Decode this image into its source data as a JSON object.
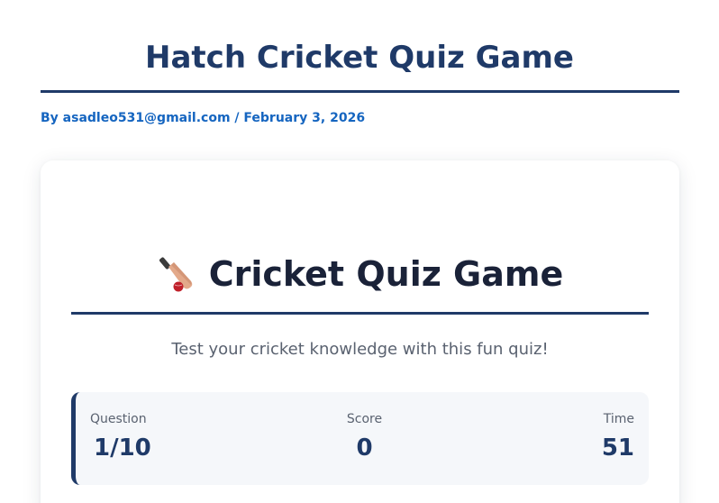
{
  "post": {
    "title": "Hatch Cricket Quiz Game",
    "byline_prefix": "By",
    "author": "asadleo531@gmail.com",
    "separator": "/",
    "date": "February 3, 2026"
  },
  "quiz": {
    "title": "Cricket Quiz Game",
    "title_icon": "cricket-bat-icon",
    "subtitle": "Test your cricket knowledge with this fun quiz!",
    "stats": {
      "question_label": "Question",
      "question_value": "1/10",
      "score_label": "Score",
      "score_value": "0",
      "time_label": "Time",
      "time_value": "51"
    }
  },
  "colors": {
    "heading_navy": "#1f3a68",
    "link_blue": "#1565c0",
    "muted_text": "#5a6270",
    "stats_bg": "#f5f7fa"
  }
}
